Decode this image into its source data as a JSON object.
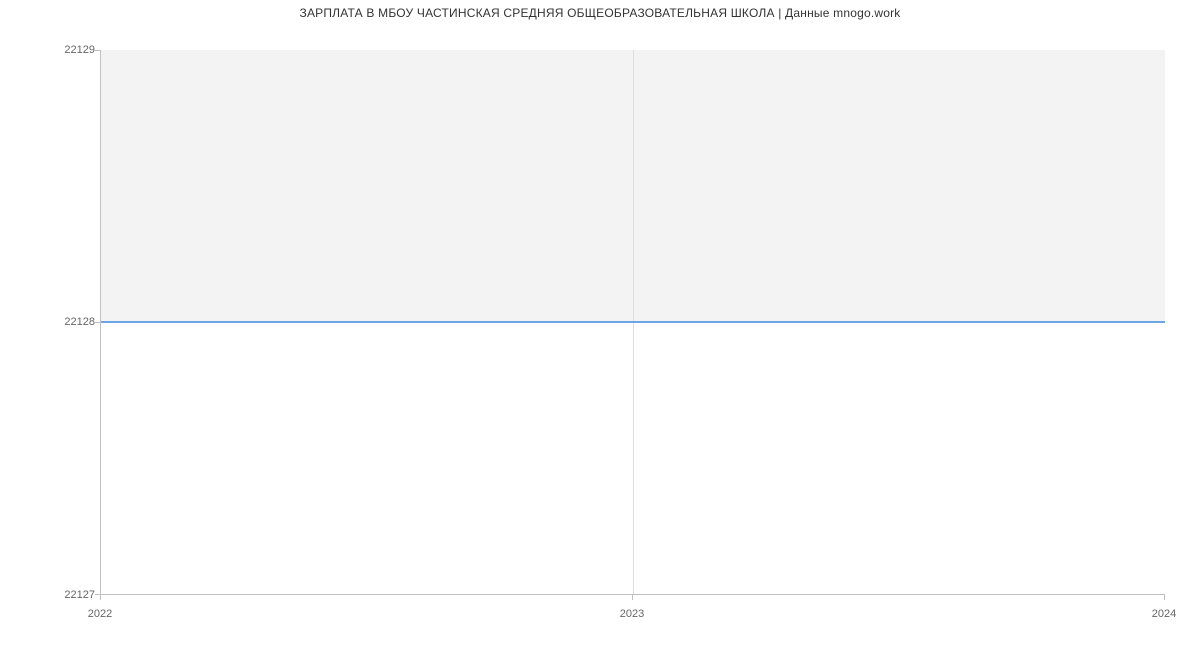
{
  "chart_data": {
    "type": "line",
    "title": "ЗАРПЛАТА В МБОУ ЧАСТИНСКАЯ СРЕДНЯЯ ОБЩЕОБРАЗОВАТЕЛЬНАЯ ШКОЛА | Данные mnogo.work",
    "xlabel": "",
    "ylabel": "",
    "x_ticks": [
      "2022",
      "2023",
      "2024"
    ],
    "y_ticks": [
      "22127",
      "22128",
      "22129"
    ],
    "x": [
      2022,
      2023,
      2024
    ],
    "values": [
      22128,
      22128,
      22128
    ],
    "ylim": [
      22127,
      22129
    ],
    "xlim": [
      2022,
      2024
    ]
  }
}
